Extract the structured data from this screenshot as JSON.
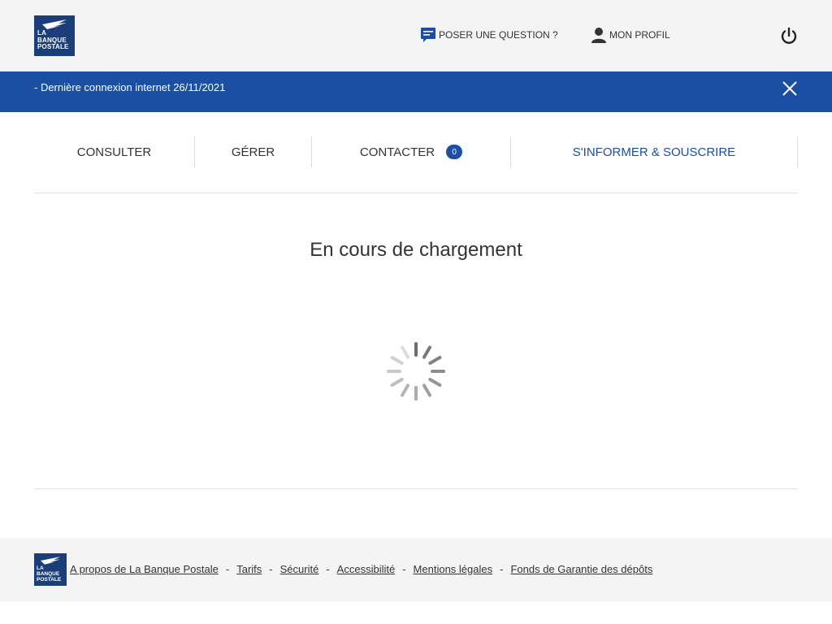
{
  "brand": {
    "logo_lines": [
      "LA",
      "BANQUE",
      "POSTALE"
    ]
  },
  "header": {
    "ask_label": "POSER UNE QUESTION ?",
    "profile_label": "MON PROFIL"
  },
  "banner": {
    "message": "- Dernière connexion internet 26/11/2021"
  },
  "nav": {
    "items": [
      {
        "label": "CONSULTER"
      },
      {
        "label": "GÉRER"
      },
      {
        "label": "CONTACTER",
        "badge": "0"
      },
      {
        "label": "S'INFORMER & SOUSCRIRE"
      }
    ]
  },
  "main": {
    "loading_text": "En cours de chargement"
  },
  "footer": {
    "links": [
      "A propos de La Banque Postale",
      "Tarifs",
      "Sécurité",
      "Accessibilité",
      "Mentions légales",
      "Fonds de Garantie des dépôts"
    ],
    "separator": "-"
  },
  "colors": {
    "brand_blue": "#1b4fa3",
    "logo_blue": "#1b3e7a",
    "header_bg": "#f4f4f4"
  },
  "icons": {
    "ask": "chat-question-icon",
    "profile": "user-icon",
    "power": "power-icon",
    "close": "close-icon",
    "spinner": "loading-spinner-icon"
  }
}
